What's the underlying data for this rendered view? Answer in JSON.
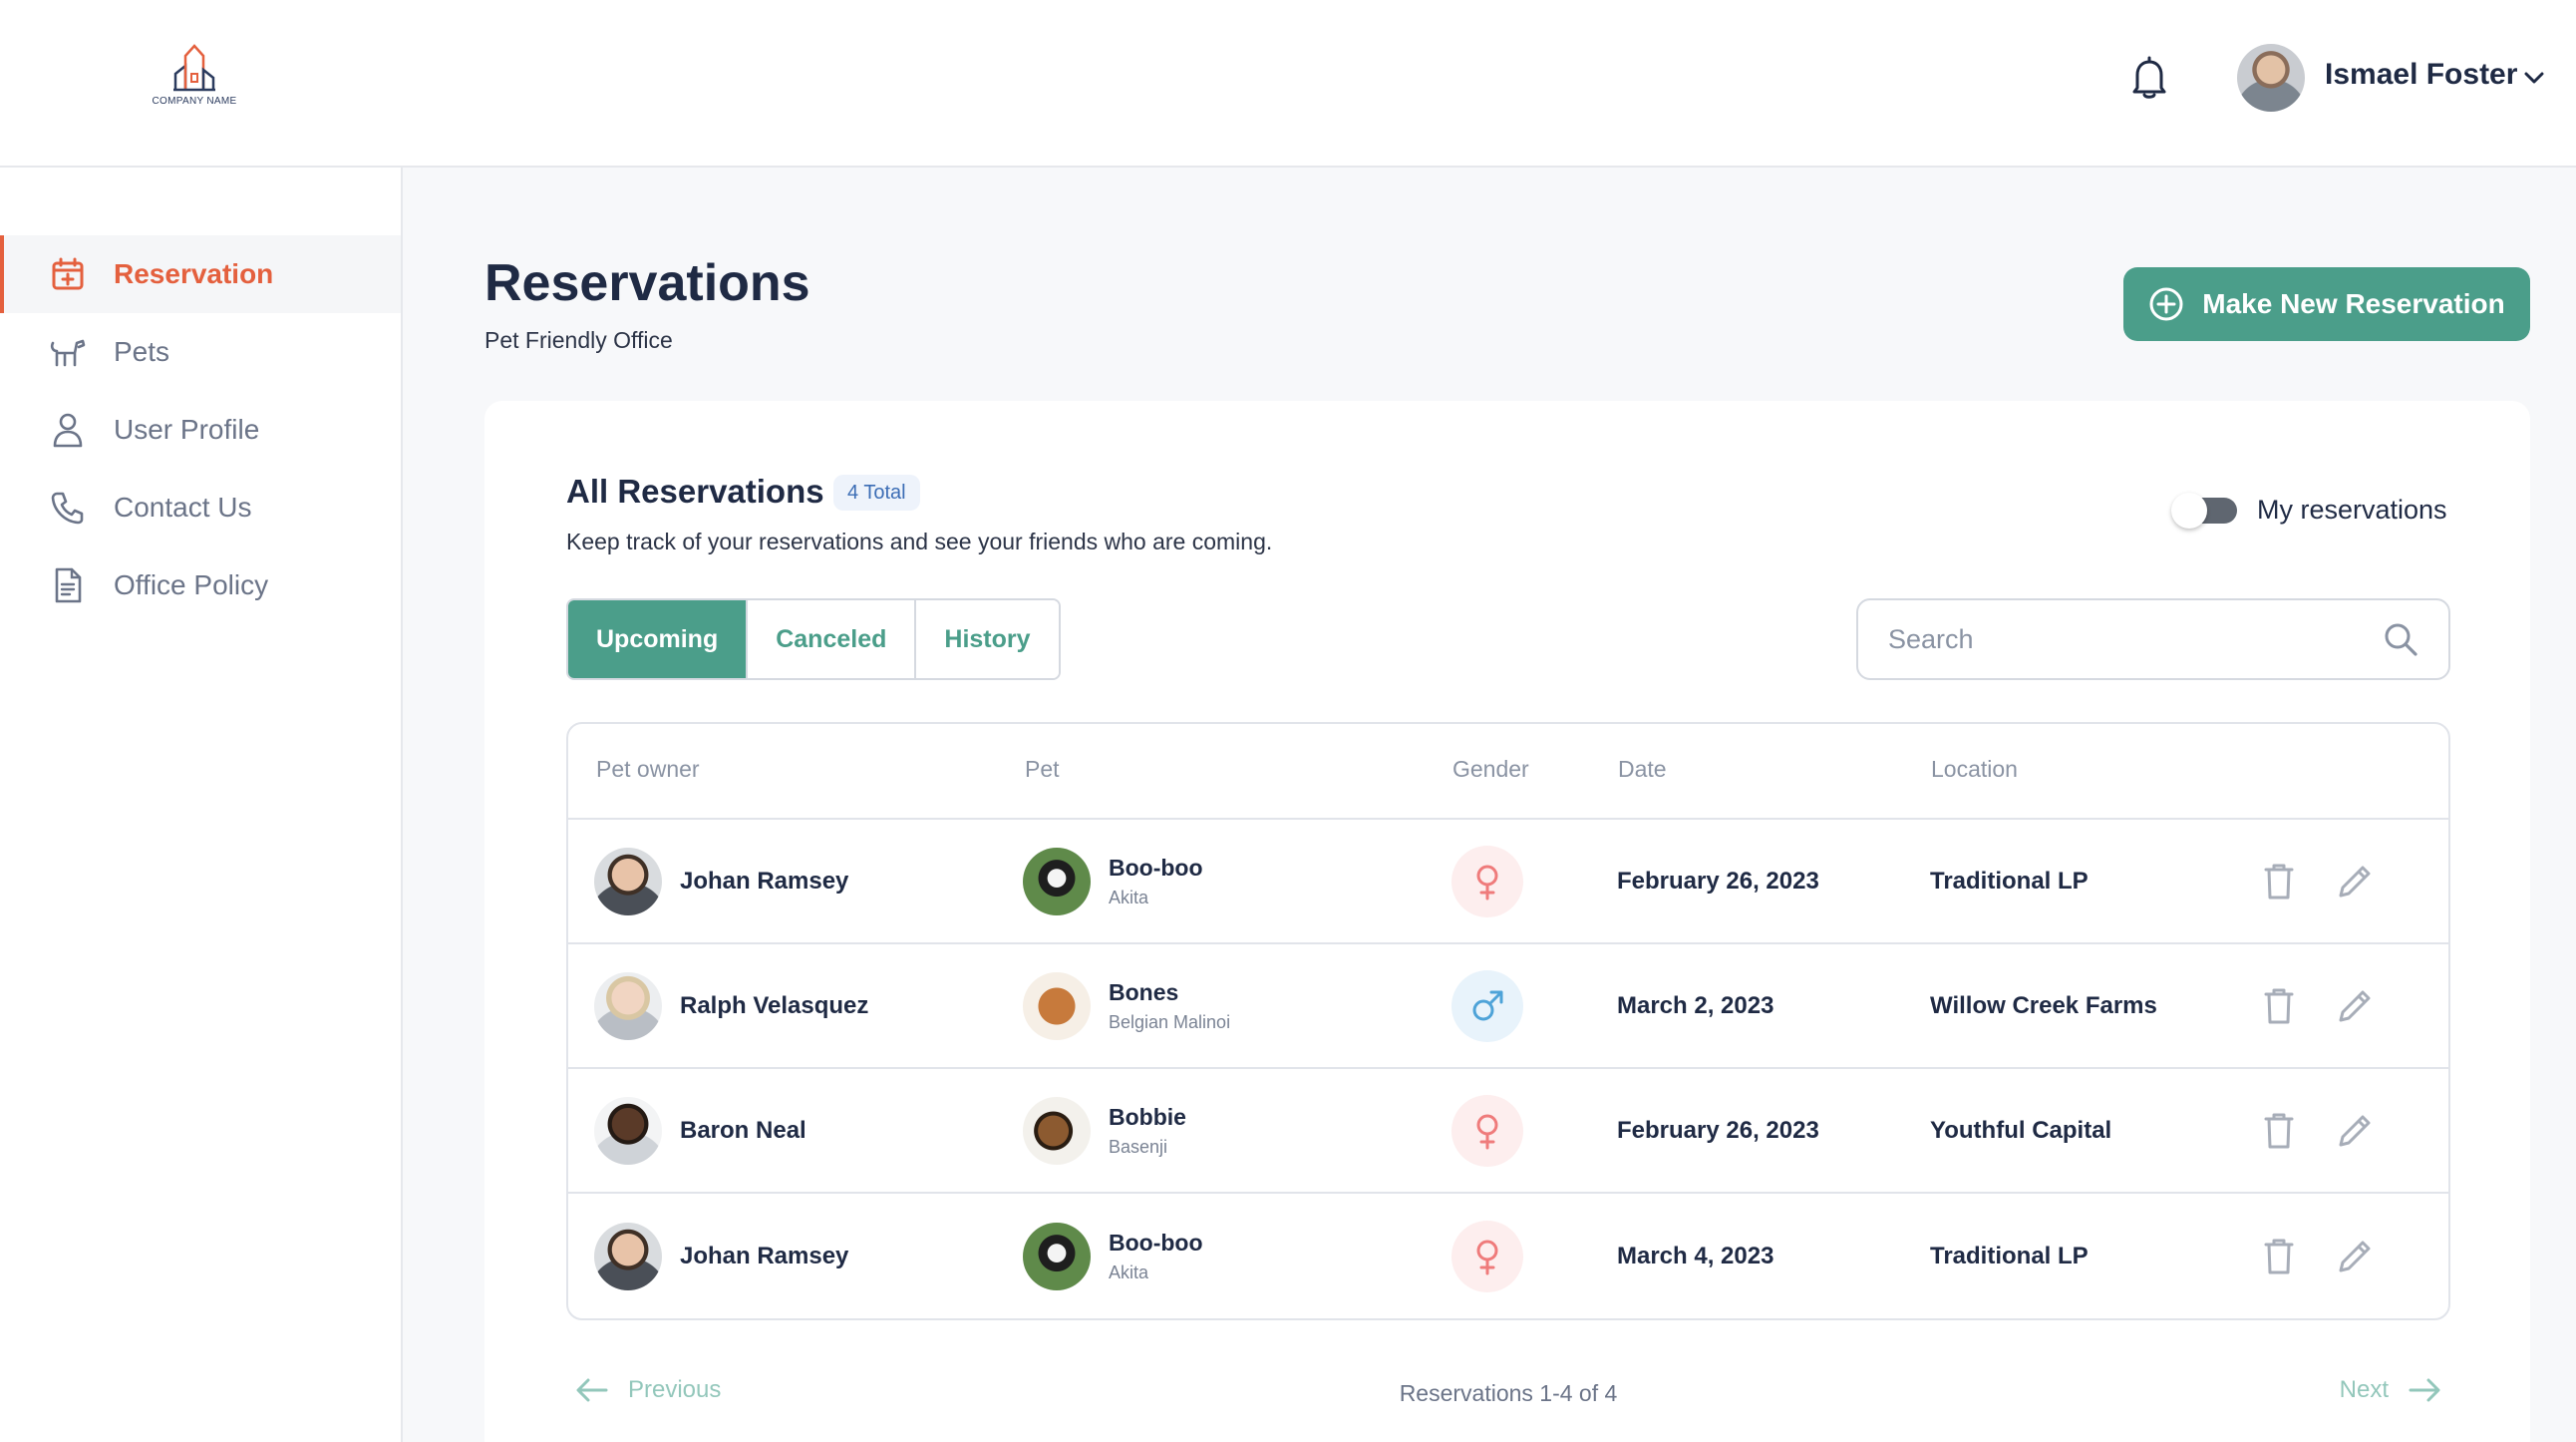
{
  "brand": {
    "company": "COMPANY NAME",
    "accent": "#e4603e",
    "primary": "#4b9e8a"
  },
  "header": {
    "user_name": "Ismael Foster",
    "bell_icon": "bell-icon",
    "chevron_icon": "chevron-down-icon"
  },
  "sidebar": {
    "items": [
      {
        "label": "Reservation",
        "icon": "calendar-plus-icon",
        "active": true
      },
      {
        "label": "Pets",
        "icon": "dog-icon",
        "active": false
      },
      {
        "label": "User Profile",
        "icon": "user-icon",
        "active": false
      },
      {
        "label": "Contact Us",
        "icon": "phone-icon",
        "active": false
      },
      {
        "label": "Office Policy",
        "icon": "document-icon",
        "active": false
      }
    ]
  },
  "main": {
    "title": "Reservations",
    "subtitle": "Pet Friendly Office",
    "new_button": "Make New Reservation"
  },
  "card": {
    "title": "All Reservations",
    "badge": "4 Total",
    "subtitle": "Keep track of your reservations and see your friends who are coming.",
    "toggle_label": "My reservations",
    "toggle_on": false,
    "tabs": [
      "Upcoming",
      "Canceled",
      "History"
    ],
    "active_tab": "Upcoming",
    "search_placeholder": "Search"
  },
  "table": {
    "headers": [
      "Pet owner",
      "Pet",
      "Gender",
      "Date",
      "Location"
    ],
    "rows": [
      {
        "owner": "Johan Ramsey",
        "pet": "Boo-boo",
        "breed": "Akita",
        "gender": "female",
        "date": "February 26, 2023",
        "location": "Traditional LP"
      },
      {
        "owner": "Ralph Velasquez",
        "pet": "Bones",
        "breed": "Belgian Malinoi",
        "gender": "male",
        "date": "March 2, 2023",
        "location": "Willow Creek Farms"
      },
      {
        "owner": "Baron Neal",
        "pet": "Bobbie",
        "breed": "Basenji",
        "gender": "female",
        "date": "February 26, 2023",
        "location": "Youthful Capital"
      },
      {
        "owner": "Johan Ramsey",
        "pet": "Boo-boo",
        "breed": "Akita",
        "gender": "female",
        "date": "March 4, 2023",
        "location": "Traditional LP"
      }
    ]
  },
  "pagination": {
    "previous": "Previous",
    "summary": "Reservations 1-4 of 4",
    "next": "Next"
  },
  "colors": {
    "female_bg": "#fdeeee",
    "female_fg": "#ef7b7b",
    "male_bg": "#e8f3fb",
    "male_fg": "#4ea3d8"
  }
}
